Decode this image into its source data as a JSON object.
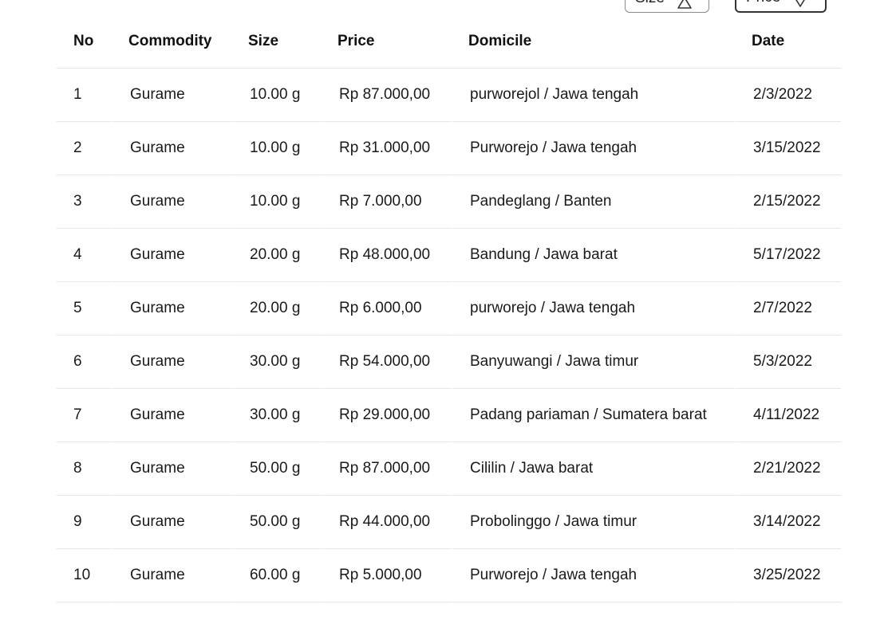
{
  "sort_buttons": {
    "size_label": "Size",
    "size_icon": "triangle-up-icon",
    "price_label": "Price",
    "price_icon": "triangle-down-icon"
  },
  "table": {
    "headers": [
      "No",
      "Commodity",
      "Size",
      "Price",
      "Domicile",
      "Date"
    ],
    "rows": [
      {
        "no": "1",
        "commodity": "Gurame",
        "size": "10.00 g",
        "price": "Rp 87.000,00",
        "domicile": "purworejol / Jawa tengah",
        "date": "2/3/2022"
      },
      {
        "no": "2",
        "commodity": "Gurame",
        "size": "10.00 g",
        "price": "Rp 31.000,00",
        "domicile": "Purworejo / Jawa tengah",
        "date": "3/15/2022"
      },
      {
        "no": "3",
        "commodity": "Gurame",
        "size": "10.00 g",
        "price": "Rp 7.000,00",
        "domicile": "Pandeglang / Banten",
        "date": "2/15/2022"
      },
      {
        "no": "4",
        "commodity": "Gurame",
        "size": "20.00 g",
        "price": "Rp 48.000,00",
        "domicile": "Bandung / Jawa barat",
        "date": "5/17/2022"
      },
      {
        "no": "5",
        "commodity": "Gurame",
        "size": "20.00 g",
        "price": "Rp 6.000,00",
        "domicile": "purworejo / Jawa tengah",
        "date": "2/7/2022"
      },
      {
        "no": "6",
        "commodity": "Gurame",
        "size": "30.00 g",
        "price": "Rp 54.000,00",
        "domicile": "Banyuwangi / Jawa timur",
        "date": "5/3/2022"
      },
      {
        "no": "7",
        "commodity": "Gurame",
        "size": "30.00 g",
        "price": "Rp 29.000,00",
        "domicile": "Padang pariaman / Sumatera barat",
        "date": "4/11/2022"
      },
      {
        "no": "8",
        "commodity": "Gurame",
        "size": "50.00 g",
        "price": "Rp 87.000,00",
        "domicile": "Cililin / Jawa barat",
        "date": "2/21/2022"
      },
      {
        "no": "9",
        "commodity": "Gurame",
        "size": "50.00 g",
        "price": "Rp 44.000,00",
        "domicile": "Probolinggo / Jawa timur",
        "date": "3/14/2022"
      },
      {
        "no": "10",
        "commodity": "Gurame",
        "size": "60.00 g",
        "price": "Rp 5.000,00",
        "domicile": "Purworejo / Jawa tengah",
        "date": "3/25/2022"
      }
    ]
  }
}
